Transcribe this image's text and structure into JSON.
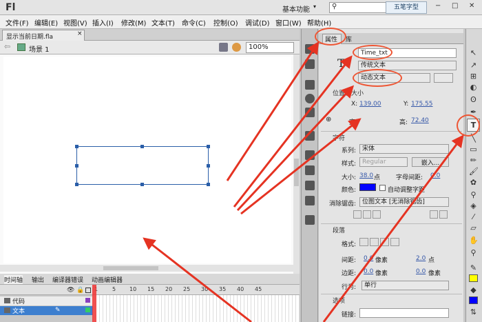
{
  "app": {
    "logo": "Fl",
    "workspace": "基本功能",
    "watermark": "五笔字型"
  },
  "window_controls": [
    "−",
    "□",
    "✕"
  ],
  "menu": [
    "文件(F)",
    "编辑(E)",
    "视图(V)",
    "插入(I)",
    "修改(M)",
    "文本(T)",
    "命令(C)",
    "控制(O)",
    "调试(D)",
    "窗口(W)",
    "帮助(H)"
  ],
  "document": {
    "tab": "显示当前日期.fla",
    "close": "×",
    "scene": "场景 1",
    "zoom": "100%"
  },
  "timeline": {
    "tabs": [
      "时间轴",
      "输出",
      "编译器错误",
      "动画编辑器"
    ],
    "ruler": [
      "1",
      "5",
      "10",
      "15",
      "20",
      "25",
      "30",
      "35",
      "40",
      "45"
    ],
    "layers": [
      {
        "name": "代码"
      },
      {
        "name": "文本"
      }
    ]
  },
  "properties": {
    "tabs": [
      "属性",
      "库"
    ],
    "instance_name": "Time_txt",
    "text_engine": "传统文本",
    "text_type": "动态文本",
    "pos_section": "位置和大小",
    "x_label": "X:",
    "x_value": "139.00",
    "y_label": "Y:",
    "y_value": "175.55",
    "w_label": "宽:",
    "w_value": "",
    "h_label": "高:",
    "h_value": "72.40",
    "char_section": "字符",
    "family_label": "系列:",
    "family_value": "宋体",
    "style_label": "样式:",
    "style_value": "Regular",
    "embed_button": "嵌入...",
    "size_label": "大小:",
    "size_value": "38.0",
    "size_unit": "点",
    "spacing_label": "字母间距:",
    "spacing_value": "0.0",
    "color_label": "颜色:",
    "color_value": "#0000ff",
    "autokern_label": "自动调整字距",
    "aa_label": "消除锯齿:",
    "aa_value": "位图文本 [无消除锯齿]",
    "para_section": "段落",
    "format_label": "格式:",
    "indent_label": "间距:",
    "indent_value": "0.0",
    "indent_unit": "像素",
    "linespace_value": "2.0",
    "linespace_unit": "点",
    "margin_label": "边距:",
    "margin_left": "0.0",
    "margin_unit": "像素",
    "margin_right": "0.0",
    "margin_right_unit": "像素",
    "behavior_label": "行为:",
    "behavior_value": "单行",
    "options_section": "选项",
    "link_label": "链接:"
  },
  "accent_colors": {
    "selection": "#2a5ea8",
    "annotation": "#e53322",
    "layer_selected": "#3d7fcf"
  }
}
